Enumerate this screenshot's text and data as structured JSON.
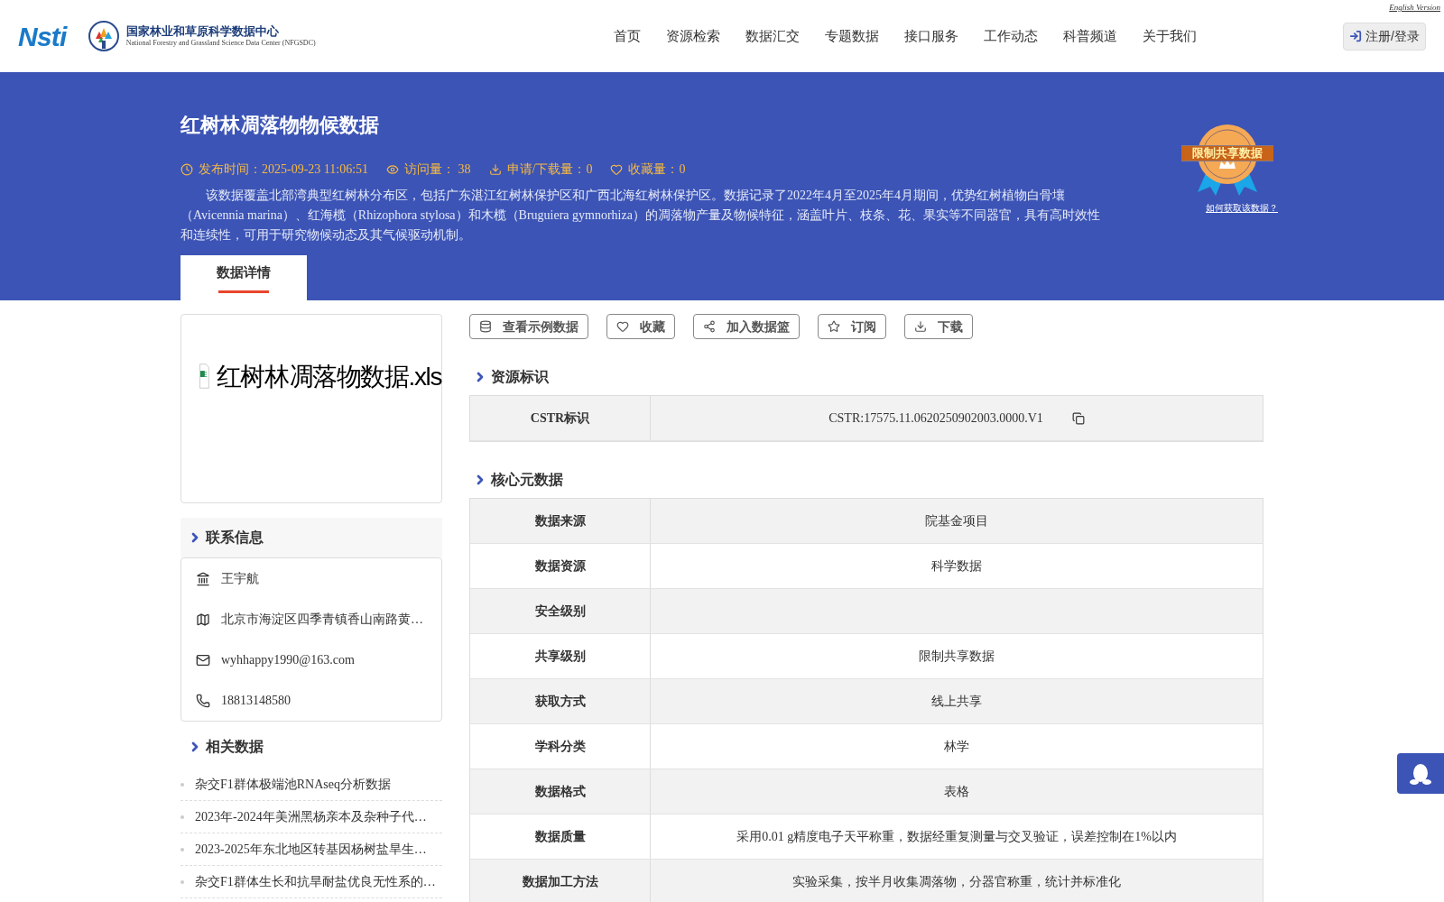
{
  "header": {
    "logo_text": "Nsti",
    "center_name": "国家林业和草原科学数据中心",
    "center_name_en": "National Forestry and Grassland Science Data Center (NFGSDC)",
    "english_link": "English Version",
    "nav": [
      "首页",
      "资源检索",
      "数据汇交",
      "专题数据",
      "接口服务",
      "工作动态",
      "科普频道",
      "关于我们"
    ],
    "login": "注册/登录"
  },
  "dataset": {
    "title": "红树林凋落物物候数据",
    "meta": [
      {
        "kind": "date",
        "text": "发布时间：2025-09-23 11:06:51"
      },
      {
        "kind": "views",
        "text": "访问量： 38"
      },
      {
        "kind": "downloads",
        "text": "申请/下载量：0"
      },
      {
        "kind": "favorites",
        "text": "收藏量：0"
      }
    ],
    "description": "该数据覆盖北部湾典型红树林分布区，包括广东湛江红树林保护区和广西北海红树林保护区。数据记录了2022年4月至2025年4月期间，优势红树植物白骨壤（Avicennia marina）、红海榄（Rhizophora stylosa）和木榄（Bruguiera gymnorhiza）的凋落物产量及物候特征，涵盖叶片、枝条、花、果实等不同器官，具有高时效性和连续性，可用于研究物候动态及其气候驱动机制。",
    "badge": {
      "label": "限制共享数据",
      "link": "如何获取该数据？"
    }
  },
  "tabs": [
    {
      "label": "数据详情",
      "selected": true
    }
  ],
  "preview": {
    "filename": "红树林凋落物数据.xls"
  },
  "contact": {
    "title": "联系信息",
    "items": [
      {
        "kind": "org",
        "text": "王宇航"
      },
      {
        "kind": "address",
        "text": "北京市海淀区四季青镇香山南路黄…"
      },
      {
        "kind": "email",
        "text": "wyhhappy1990@163.com"
      },
      {
        "kind": "phone",
        "text": "18813148580"
      }
    ]
  },
  "related": {
    "title": "相关数据",
    "items": [
      "杂交F1群体极端池RNAseq分析数据",
      "2023年-2024年美洲黑杨亲本及杂种子代…",
      "2023-2025年东北地区转基因杨树盐旱生…",
      "杂交F1群体生长和抗旱耐盐优良无性系的…"
    ]
  },
  "actions": [
    {
      "kind": "sample",
      "label": "查看示例数据"
    },
    {
      "kind": "favorite",
      "label": "收藏"
    },
    {
      "kind": "basket",
      "label": "加入数据篮"
    },
    {
      "kind": "subscribe",
      "label": "订阅"
    },
    {
      "kind": "download",
      "label": "下载"
    }
  ],
  "sections": [
    {
      "title": "资源标识",
      "rows": [
        {
          "label": "CSTR标识",
          "value": "CSTR:17575.11.0620250902003.0000.V1",
          "copyable": true
        }
      ]
    },
    {
      "title": "核心元数据",
      "rows": [
        {
          "label": "数据来源",
          "value": "院基金项目"
        },
        {
          "label": "数据资源",
          "value": "科学数据"
        },
        {
          "label": "安全级别"
        },
        {
          "label": "共享级别",
          "value": "限制共享数据"
        },
        {
          "label": "获取方式",
          "value": "线上共享"
        },
        {
          "label": "学科分类",
          "value": "林学"
        },
        {
          "label": "数据格式",
          "value": "表格"
        },
        {
          "label": "数据质量",
          "value": "采用0.01 g精度电子天平称重，数据经重复测量与交叉验证，误差控制在1%以内"
        },
        {
          "label": "数据加工方法",
          "value": "实验采集，按半月收集凋落物，分器官称重，统计并标准化"
        }
      ]
    }
  ]
}
